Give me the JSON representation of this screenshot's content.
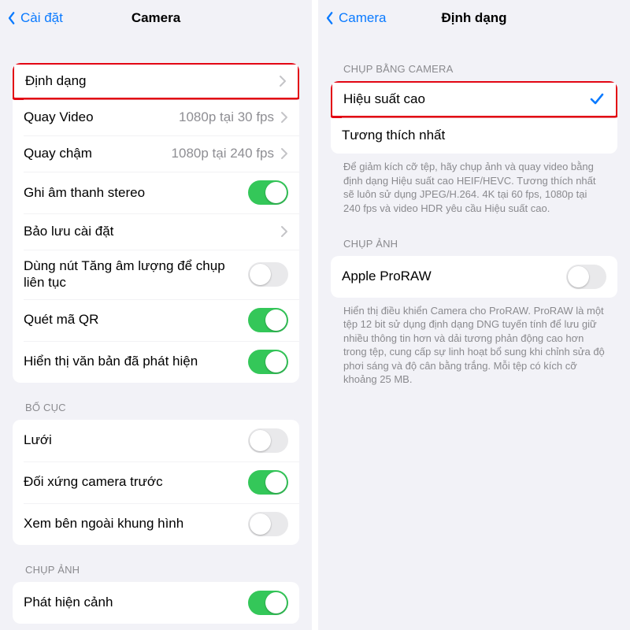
{
  "left": {
    "back_label": "Cài đặt",
    "title": "Camera",
    "group1": {
      "rows": [
        {
          "label": "Định dạng",
          "type": "disclosure",
          "value": "",
          "highlight": true
        },
        {
          "label": "Quay Video",
          "type": "value_disclosure",
          "value": "1080p tại 30 fps"
        },
        {
          "label": "Quay chậm",
          "type": "value_disclosure",
          "value": "1080p tại 240 fps"
        },
        {
          "label": "Ghi âm thanh stereo",
          "type": "switch",
          "on": true
        },
        {
          "label": "Bảo lưu cài đặt",
          "type": "disclosure",
          "value": ""
        },
        {
          "label": "Dùng nút Tăng âm lượng để chụp liên tục",
          "type": "switch",
          "on": false
        },
        {
          "label": "Quét mã QR",
          "type": "switch",
          "on": true
        },
        {
          "label": "Hiển thị văn bản đã phát hiện",
          "type": "switch",
          "on": true
        }
      ]
    },
    "group2": {
      "header": "BỐ CỤC",
      "rows": [
        {
          "label": "Lưới",
          "type": "switch",
          "on": false
        },
        {
          "label": "Đối xứng camera trước",
          "type": "switch",
          "on": true
        },
        {
          "label": "Xem bên ngoài khung hình",
          "type": "switch",
          "on": false
        }
      ]
    },
    "group3": {
      "header": "CHỤP ẢNH",
      "rows": [
        {
          "label": "Phát hiện cảnh",
          "type": "switch",
          "on": true
        }
      ]
    }
  },
  "right": {
    "back_label": "Camera",
    "title": "Định dạng",
    "group1": {
      "header": "CHỤP BẰNG CAMERA",
      "rows": [
        {
          "label": "Hiệu suất cao",
          "type": "check",
          "selected": true,
          "highlight": true
        },
        {
          "label": "Tương thích nhất",
          "type": "check",
          "selected": false
        }
      ],
      "footer": "Để giảm kích cỡ tệp, hãy chụp ảnh và quay video bằng định dạng Hiệu suất cao HEIF/HEVC. Tương thích nhất sẽ luôn sử dụng JPEG/H.264. 4K tại 60 fps, 1080p tại 240 fps và video HDR yêu cầu Hiệu suất cao."
    },
    "group2": {
      "header": "CHỤP ẢNH",
      "rows": [
        {
          "label": "Apple ProRAW",
          "type": "switch",
          "on": false
        }
      ],
      "footer": "Hiển thị điều khiển Camera cho ProRAW. ProRAW là một tệp 12 bit sử dụng định dạng DNG tuyến tính để lưu giữ nhiều thông tin hơn và dải tương phản động cao hơn trong tệp, cung cấp sự linh hoạt bổ sung khi chỉnh sửa độ phơi sáng và độ cân bằng trắng. Mỗi tệp có kích cỡ khoảng 25 MB."
    }
  }
}
